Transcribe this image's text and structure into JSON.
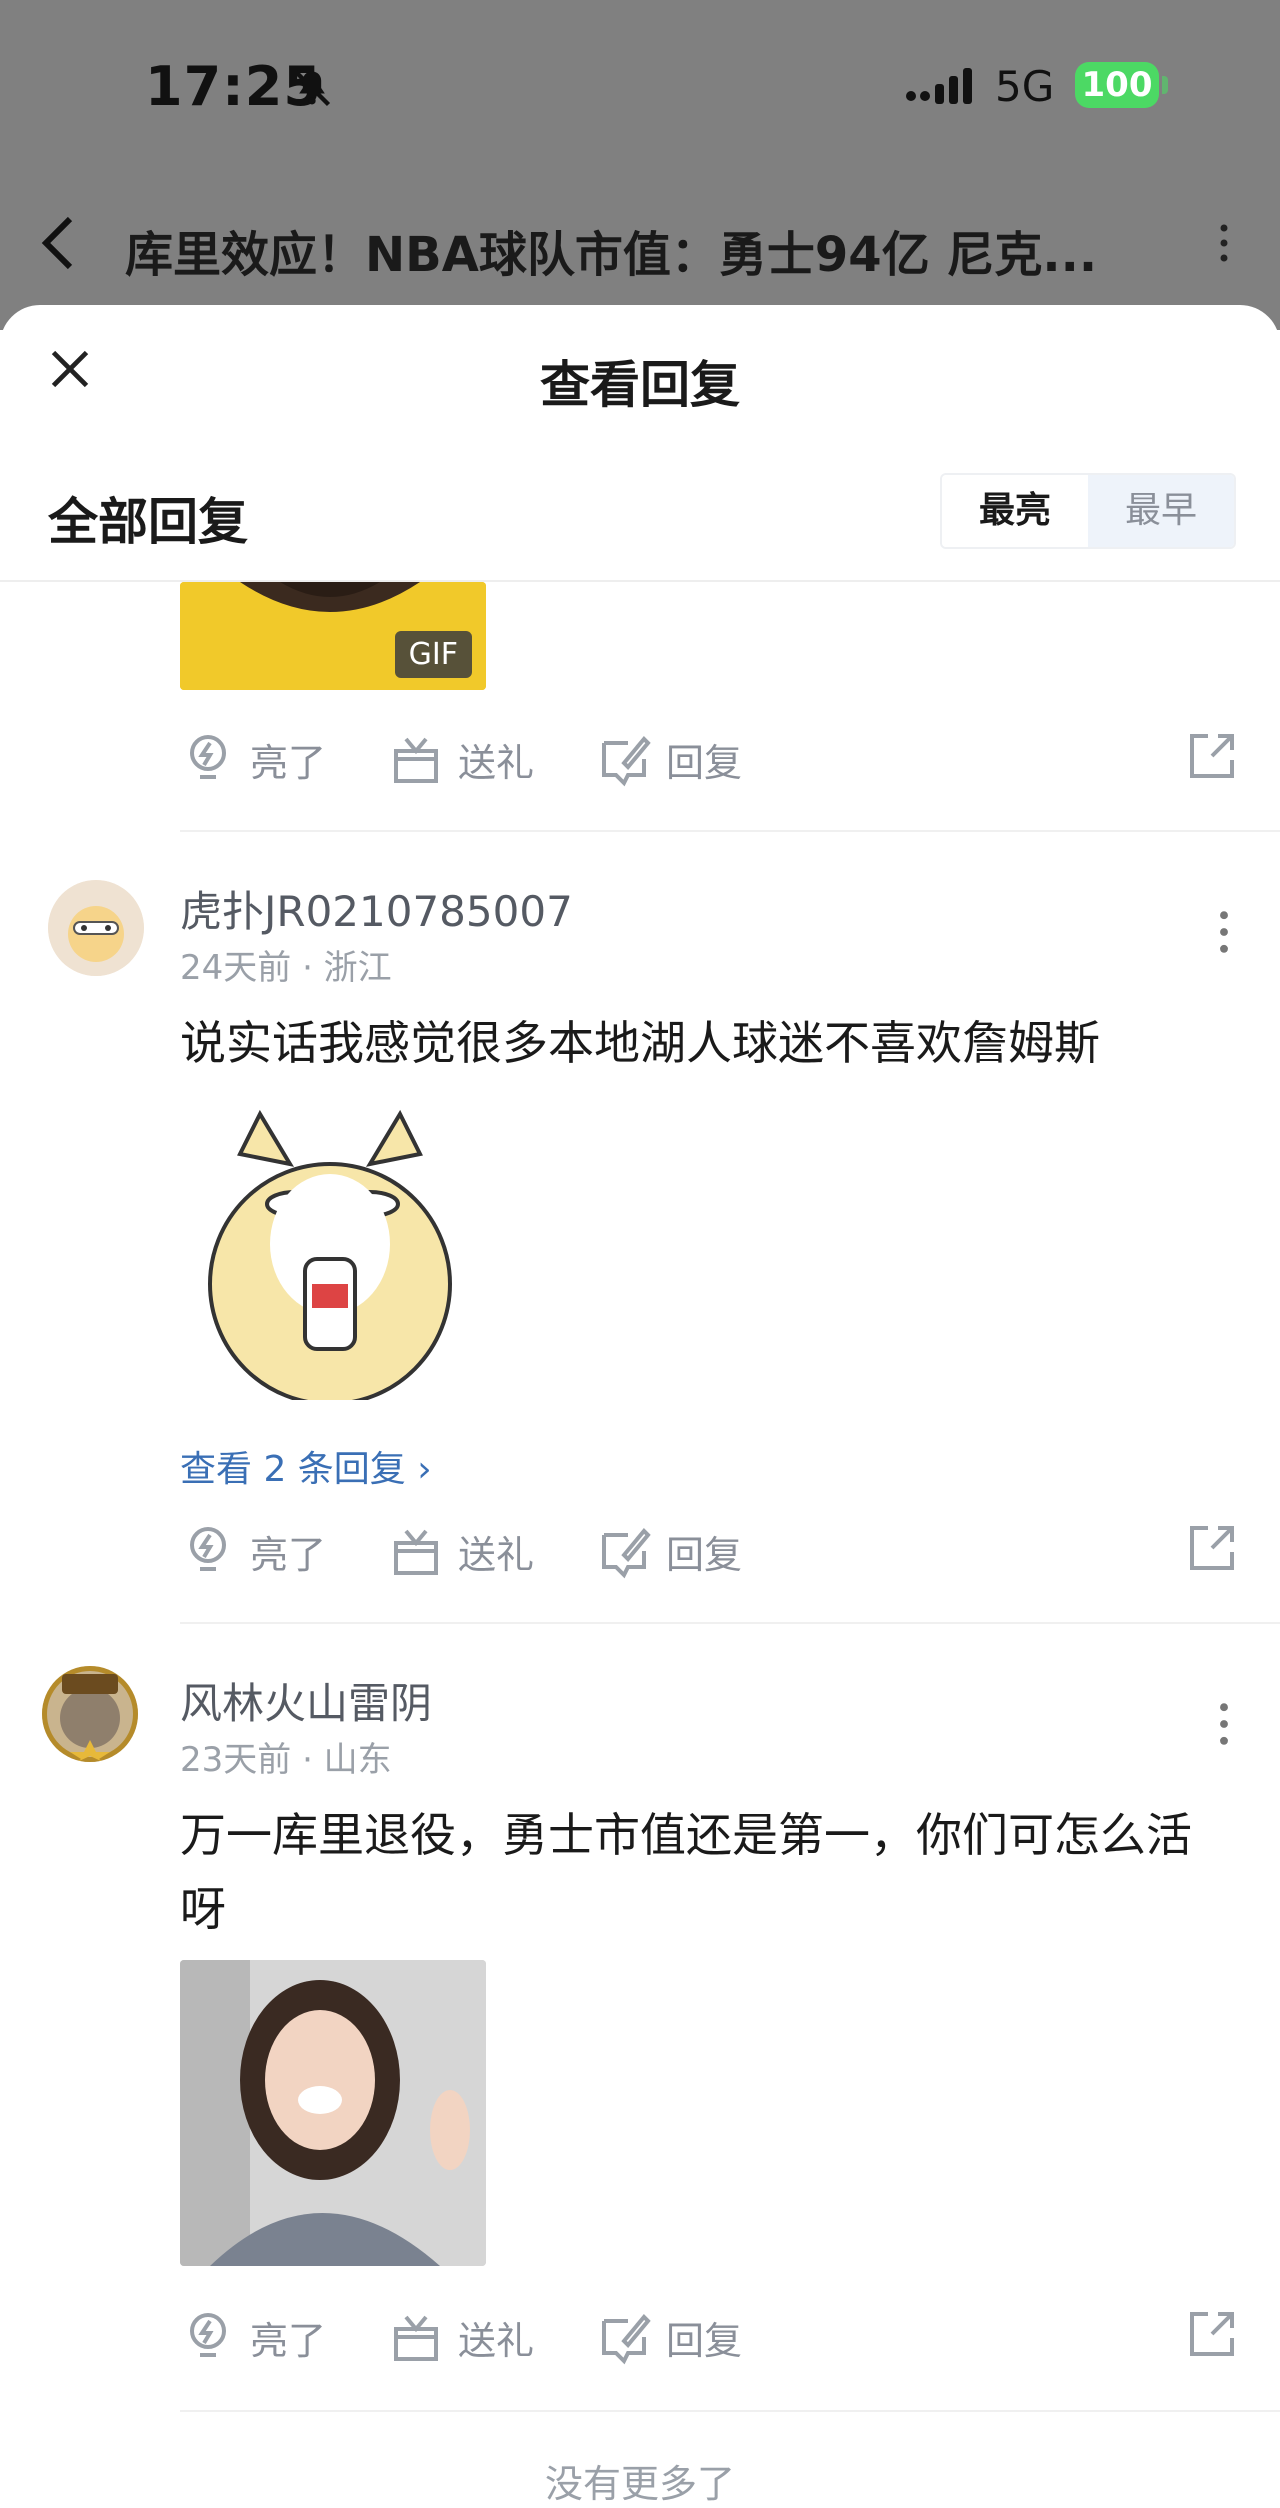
{
  "status_bar": {
    "time": "17:25",
    "network": "5G",
    "battery": "100"
  },
  "nav": {
    "title": "库里效应！NBA球队市值：勇士94亿 尼克..."
  },
  "sheet": {
    "title": "查看回复",
    "section_title": "全部回复",
    "sort": {
      "active": "最亮",
      "inactive": "最早"
    }
  },
  "partial_comment": {
    "gif_badge": "GIF",
    "actions": {
      "light": "亮了",
      "gift": "送礼",
      "reply": "回复"
    }
  },
  "comments": [
    {
      "username": "虎扑JR0210785007",
      "meta": "24天前 · 浙江",
      "text": "说实话我感觉很多本地湖人球迷不喜欢詹姆斯",
      "view_replies": "查看 2 条回复",
      "actions": {
        "light": "亮了",
        "gift": "送礼",
        "reply": "回复"
      }
    },
    {
      "username": "风林火山雷阴",
      "meta": "23天前 · 山东",
      "text": "万一库里退役，勇士市值还是第一，你们可怎么活呀",
      "actions": {
        "light": "亮了",
        "gift": "送礼",
        "reply": "回复"
      }
    }
  ],
  "footer": {
    "no_more": "没有更多了"
  },
  "colors": {
    "link": "#3a6fb5",
    "muted": "#8a8f99",
    "battery": "#4cd964"
  }
}
